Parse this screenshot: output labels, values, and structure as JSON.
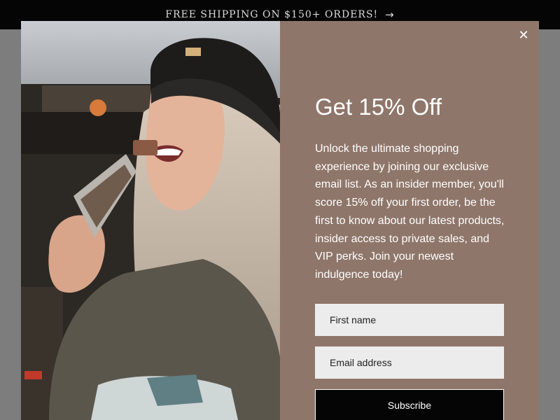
{
  "announcement": {
    "text": "FREE SHIPPING ON $150+ ORDERS!",
    "arrow_icon": "arrow-right-icon"
  },
  "modal": {
    "close_icon": "close-icon",
    "close_glyph": "✕",
    "image": {
      "description_icon": "promo-photo"
    },
    "title": "Get 15% Off",
    "body": "Unlock the ultimate shopping experience by joining our exclusive email list. As an insider member, you'll score 15% off your first order, be the first to know about our latest products, insider access to private sales, and VIP perks. Join your newest indulgence today!",
    "first_name_placeholder": "First name",
    "email_placeholder": "Email address",
    "subscribe_label": "Subscribe"
  },
  "colors": {
    "announce_bg": "#050505",
    "panel_bg": "#8f766a",
    "field_bg": "#ececec",
    "button_bg": "#050505"
  }
}
